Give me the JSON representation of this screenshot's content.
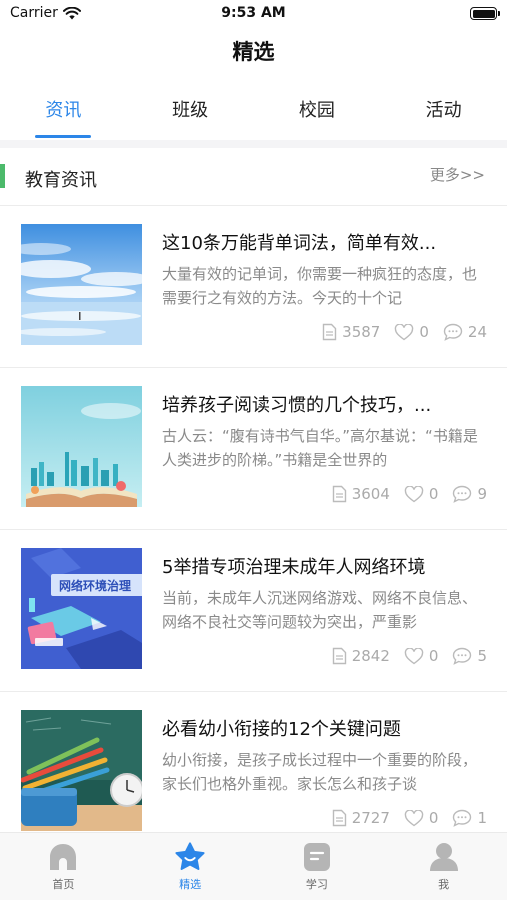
{
  "status_bar": {
    "carrier": "Carrier",
    "time": "9:53 AM"
  },
  "header": {
    "title": "精选"
  },
  "tabs": [
    {
      "label": "资讯",
      "active": true
    },
    {
      "label": "班级",
      "active": false
    },
    {
      "label": "校园",
      "active": false
    },
    {
      "label": "活动",
      "active": false
    }
  ],
  "section": {
    "title": "教育资讯",
    "more_label": "更多>>",
    "marker_color": "#4cba6b"
  },
  "articles": [
    {
      "title": "这10条万能背单词法，简单有效...",
      "summary": "大量有效的记单词，你需要一种疯狂的态度，也需要行之有效的方法。今天的十个记",
      "views": "3587",
      "likes": "0",
      "comments": "24",
      "thumb_icon": "sky-landscape-image"
    },
    {
      "title": "培养孩子阅读习惯的几个技巧，...",
      "summary": "古人云：“腹有诗书气自华。”高尔基说：“书籍是人类进步的阶梯。”书籍是全世界的",
      "views": "3604",
      "likes": "0",
      "comments": "9",
      "thumb_icon": "city-book-image"
    },
    {
      "title": "5举措专项治理未成年人网络环境",
      "summary": "当前，未成年人沉迷网络游戏、网络不良信息、网络不良社交等问题较为突出，严重影",
      "views": "2842",
      "likes": "0",
      "comments": "5",
      "thumb_icon": "network-environment-image",
      "thumb_text": "网络环境治理"
    },
    {
      "title": "必看幼小衔接的12个关键问题",
      "summary": "幼小衔接，是孩子成长过程中一个重要的阶段，家长们也格外重视。家长怎么和孩子谈",
      "views": "2727",
      "likes": "0",
      "comments": "1",
      "thumb_icon": "pencils-clock-image"
    }
  ],
  "tabbar": [
    {
      "label": "首页",
      "icon": "home-icon",
      "active": false
    },
    {
      "label": "精选",
      "icon": "star-icon",
      "active": true
    },
    {
      "label": "学习",
      "icon": "study-icon",
      "active": false
    },
    {
      "label": "我",
      "icon": "profile-icon",
      "active": false
    }
  ],
  "colors": {
    "accent": "#2c86e8",
    "section_marker": "#4cba6b",
    "muted": "#8a8a8a"
  }
}
